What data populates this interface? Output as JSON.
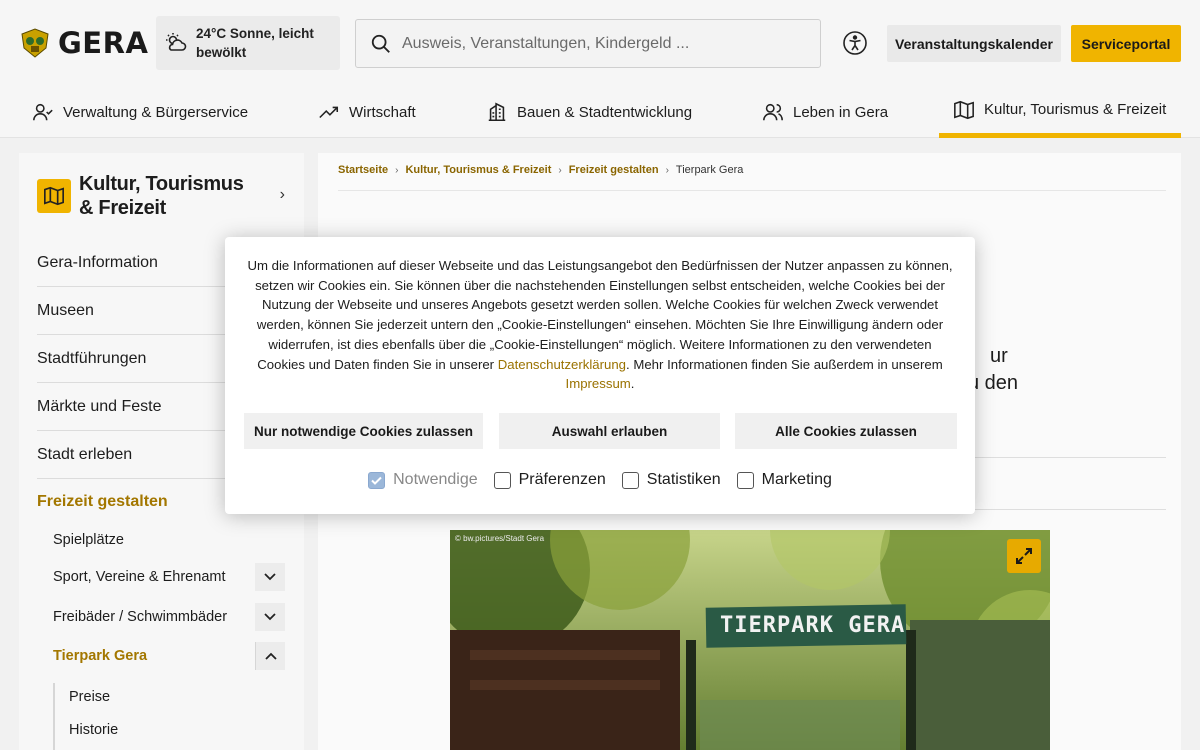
{
  "header": {
    "logo_text": "GERA",
    "weather": "24°C Sonne, leicht bewölkt",
    "search_placeholder": "Ausweis, Veranstaltungen, Kindergeld ...",
    "veranstaltungskalender_label": "Veranstaltungskalender",
    "serviceportal_label": "Serviceportal"
  },
  "nav": {
    "items": [
      {
        "label": "Verwaltung & Bürgerservice",
        "icon": "person-icon"
      },
      {
        "label": "Wirtschaft",
        "icon": "trend-icon"
      },
      {
        "label": "Bauen & Stadtentwicklung",
        "icon": "building-icon"
      },
      {
        "label": "Leben in Gera",
        "icon": "people-icon"
      },
      {
        "label": "Kultur, Tourismus & Freizeit",
        "icon": "map-icon"
      }
    ],
    "active_index": 4
  },
  "sidebar": {
    "title": "Kultur, Tourismus & Freizeit",
    "items": [
      {
        "label": "Gera-Information"
      },
      {
        "label": "Museen"
      },
      {
        "label": "Stadtführungen"
      },
      {
        "label": "Märkte und Feste"
      },
      {
        "label": "Stadt erleben"
      },
      {
        "label": "Freizeit gestalten"
      }
    ],
    "sub_items": [
      {
        "label": "Spielplätze"
      },
      {
        "label": "Sport, Vereine & Ehrenamt"
      },
      {
        "label": "Freibäder / Schwimmbäder"
      },
      {
        "label": "Tierpark Gera"
      }
    ],
    "sub_sub_items": [
      {
        "label": "Preise"
      },
      {
        "label": "Historie"
      }
    ]
  },
  "breadcrumb": [
    "Startseite",
    "Kultur, Tourismus & Freizeit",
    "Freizeit gestalten",
    "Tierpark Gera"
  ],
  "content": {
    "photo_credit": "© bw.pictures/Stadt Gera",
    "sign_text": "TIERPARK GERA",
    "bg_text_1": "ur",
    "bg_text_2": "u den"
  },
  "cookie": {
    "text_1": "Um die Informationen auf dieser Webseite und das Leistungsangebot den Bedürfnissen der Nutzer anpassen zu können, setzen wir Cookies ein. Sie können über die nachstehenden Einstellungen selbst entscheiden, welche Cookies bei der Nutzung der Webseite und unseres Angebots gesetzt werden sollen. Welche Cookies für welchen Zweck verwendet werden, können Sie jederzeit untern den „Cookie-Einstellungen“ einsehen. Möchten Sie Ihre Einwilligung ändern oder widerrufen, ist dies ebenfalls über die „Cookie-Einstellungen“ möglich. Weitere Informationen zu den verwendeten Cookies und Daten finden Sie in unserer ",
    "link_privacy": "Datenschutzerklärung",
    "text_2": ". Mehr Informationen finden Sie außerdem in unserem ",
    "link_imprint": "Impressum",
    "text_3": ".",
    "btn_necessary": "Nur notwendige Cookies zulassen",
    "btn_selection": "Auswahl erlauben",
    "btn_all": "Alle Cookies zulassen",
    "checkboxes": [
      {
        "label": "Notwendige",
        "checked": true,
        "disabled": true
      },
      {
        "label": "Präferenzen",
        "checked": false
      },
      {
        "label": "Statistiken",
        "checked": false
      },
      {
        "label": "Marketing",
        "checked": false
      }
    ]
  },
  "colors": {
    "accent": "#f0b400",
    "link": "#9a7200"
  }
}
